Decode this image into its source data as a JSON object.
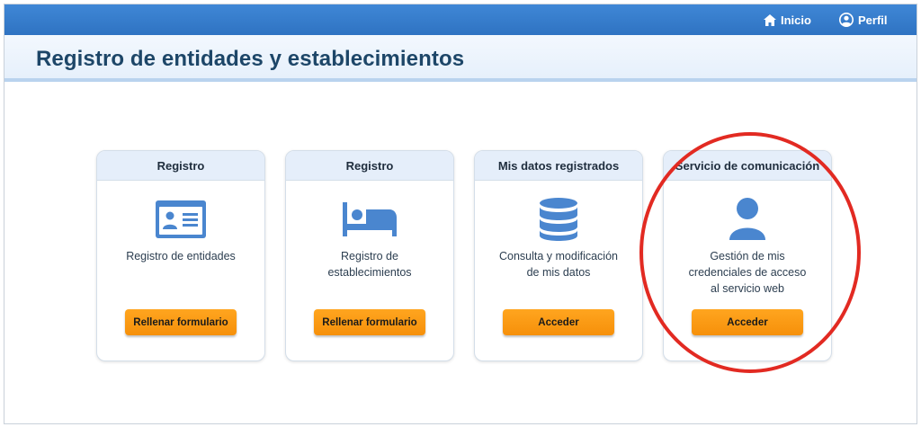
{
  "nav": {
    "home_label": "Inicio",
    "profile_label": "Perfil"
  },
  "page": {
    "title": "Registro de entidades y establecimientos"
  },
  "cards": [
    {
      "header": "Registro",
      "lines": [
        "Registro de entidades"
      ],
      "button": "Rellenar formulario",
      "icon": "id-card-icon"
    },
    {
      "header": "Registro",
      "lines": [
        "Registro de",
        "establecimientos"
      ],
      "button": "Rellenar formulario",
      "icon": "bed-icon"
    },
    {
      "header": "Mis datos registrados",
      "lines": [
        "Consulta y modificación",
        "de mis datos"
      ],
      "button": "Acceder",
      "icon": "database-icon"
    },
    {
      "header": "Servicio de comunicación",
      "lines": [
        "Gestión de mis",
        "credenciales de acceso",
        "al servicio web"
      ],
      "button": "Acceder",
      "icon": "user-icon"
    }
  ],
  "colors": {
    "accent_blue": "#2f73c2",
    "icon_blue": "#4a86cf",
    "button_orange": "#f6900a",
    "annotation_red": "#e22a22"
  }
}
